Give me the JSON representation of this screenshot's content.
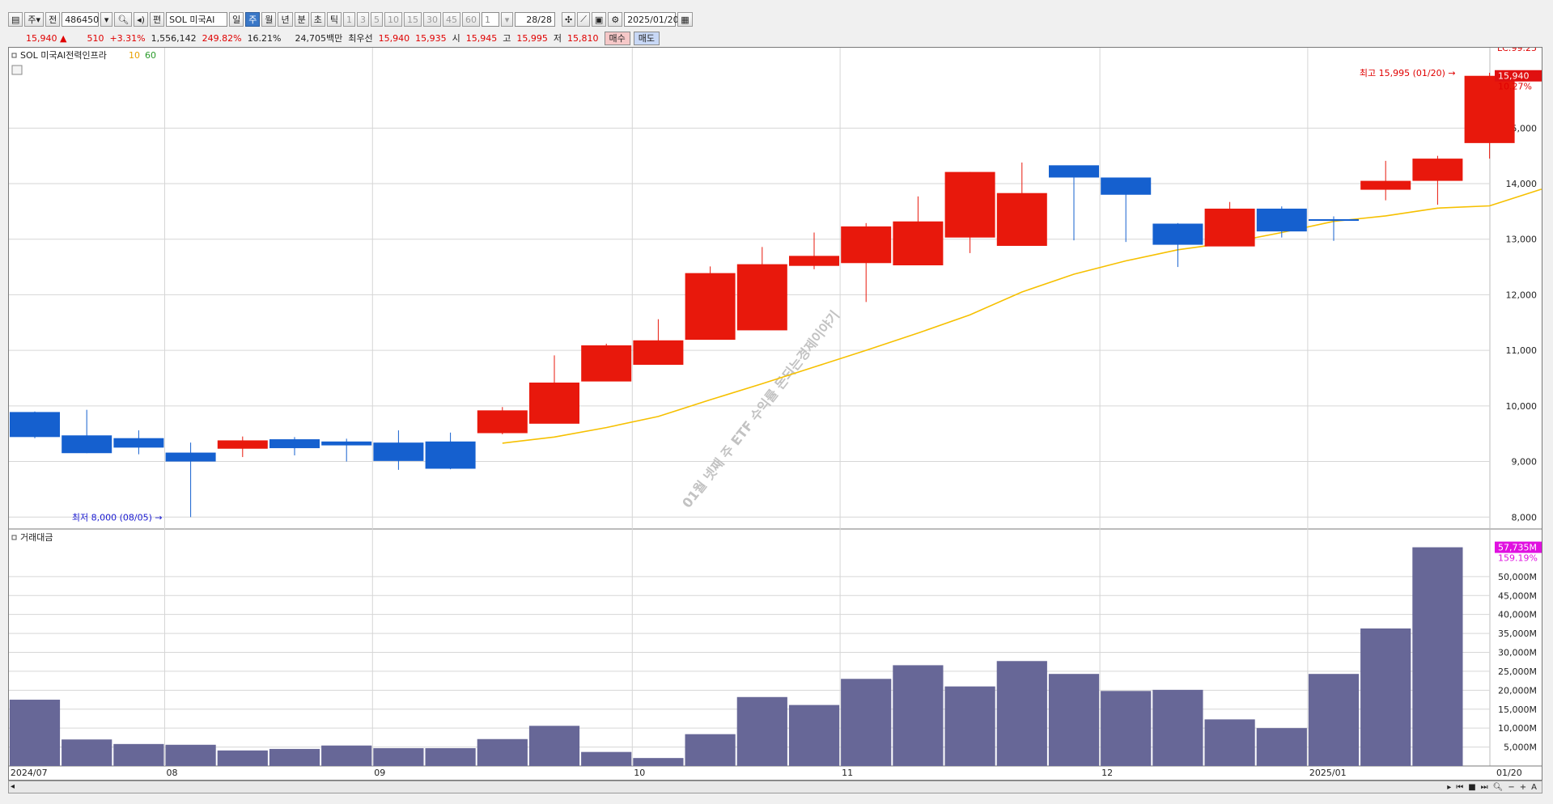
{
  "toolbar": {
    "period_items": [
      "주"
    ],
    "all_label": "전",
    "code": "486450",
    "edit_label": "편",
    "stock_name": "SOL 미국AI",
    "intervals": [
      "일",
      "주",
      "월",
      "년",
      "분",
      "초",
      "틱"
    ],
    "active_interval": "주",
    "minute_options": [
      "1",
      "3",
      "5",
      "10",
      "15",
      "30",
      "45",
      "60"
    ],
    "custom_value": "1",
    "count_display": "28/28",
    "date": "2025/01/20"
  },
  "quote": {
    "price": "15,940 ▲",
    "change": "510",
    "change_pct": "+3.31%",
    "volume": "1,556,142",
    "vol_ratio": "249.82%",
    "turnover": "16.21%",
    "amount": "24,705백만",
    "best_label": "최우선",
    "ask": "15,940",
    "bid": "15,935",
    "open_label": "시",
    "open": "15,945",
    "high_label": "고",
    "high": "15,995",
    "low_label": "저",
    "low": "15,810",
    "buy_label": "매수",
    "sell_label": "매도"
  },
  "price_panel": {
    "name": "SOL 미국AI전력인프라",
    "ma_labels": [
      "10",
      "60"
    ],
    "lc_label": "LC:99.25",
    "current_price_tag": "15,940",
    "current_pct": "10.27%",
    "high_annotation": "최고 15,995 (01/20)",
    "low_annotation": "최저 8,000 (08/05)",
    "watermark": "01월 넷째 주 ETF 수익률 돈되는경제이야기"
  },
  "volume_panel": {
    "name": "거래대금",
    "value_tag": "57,735M",
    "pct": "159.19%"
  },
  "colors": {
    "up": "#e8180c",
    "down": "#1560cf",
    "ma": "#f6c000",
    "volume": "#676797"
  },
  "chart_data": [
    {
      "type": "candlestick",
      "title": "SOL 미국AI전력인프라",
      "x": [
        "2024/07/08",
        "2024/07/15",
        "2024/07/22",
        "2024/07/29",
        "2024/08/05",
        "2024/08/12",
        "2024/08/19",
        "2024/08/26",
        "2024/09/02",
        "2024/09/09",
        "2024/09/16",
        "2024/09/23",
        "2024/09/30",
        "2024/10/07",
        "2024/10/14",
        "2024/10/21",
        "2024/10/28",
        "2024/11/04",
        "2024/11/11",
        "2024/11/18",
        "2024/11/25",
        "2024/12/02",
        "2024/12/09",
        "2024/12/16",
        "2024/12/23",
        "2024/12/30",
        "2025/01/06",
        "2025/01/13",
        "2025/01/20"
      ],
      "series": [
        {
          "open": [
            9890,
            9470,
            9420,
            9160,
            9230,
            9400,
            9360,
            9340,
            9360,
            9510,
            9680,
            10440,
            10740,
            11190,
            11360,
            12520,
            12570,
            12530,
            13030,
            12880,
            14330,
            14110,
            13280,
            12870,
            13550,
            13360,
            13890,
            14050,
            14730
          ],
          "high": [
            9900,
            9930,
            9560,
            9340,
            9450,
            9440,
            9410,
            9560,
            9520,
            9980,
            10910,
            11120,
            11560,
            12510,
            12860,
            13120,
            13290,
            13770,
            14210,
            14380,
            14180,
            14020,
            13290,
            13670,
            13590,
            13410,
            14410,
            14500,
            15995
          ],
          "low": [
            9420,
            9150,
            9130,
            8000,
            9080,
            9110,
            9000,
            8850,
            8860,
            9490,
            10390,
            10570,
            11100,
            11280,
            12320,
            12460,
            11870,
            13000,
            12750,
            13680,
            12980,
            12950,
            12500,
            13030,
            13030,
            12970,
            13700,
            13620,
            14450
          ],
          "close": [
            9440,
            9150,
            9250,
            9000,
            9380,
            9240,
            9290,
            9010,
            8870,
            9920,
            10420,
            11090,
            11180,
            12390,
            12550,
            12700,
            13230,
            13320,
            14210,
            13830,
            14110,
            13800,
            12900,
            13550,
            13140,
            13330,
            14050,
            14450,
            15940
          ]
        }
      ],
      "ma_values": [
        null,
        null,
        null,
        null,
        null,
        null,
        null,
        null,
        null,
        9330,
        9440,
        9610,
        9810,
        10110,
        10400,
        10700,
        11000,
        11310,
        11640,
        12050,
        12370,
        12610,
        12810,
        12940,
        13120,
        13320,
        13420,
        13560,
        13600,
        13900
      ],
      "x_ticks": [
        "2024/07",
        "08",
        "09",
        "10",
        "11",
        "12",
        "2025/01",
        "01/20"
      ],
      "y_ticks": [
        8000,
        9000,
        10000,
        11000,
        12000,
        13000,
        14000,
        15000
      ],
      "y_range": [
        7800,
        16300
      ],
      "grid": true
    },
    {
      "type": "bar",
      "title": "거래대금",
      "values": [
        17500,
        7000,
        5800,
        5600,
        4100,
        4500,
        5400,
        4700,
        4700,
        7100,
        10600,
        3700,
        2100,
        8400,
        18200,
        16100,
        23000,
        26600,
        21000,
        27700,
        24300,
        19800,
        20100,
        12300,
        10000,
        24300,
        36300,
        57735
      ],
      "y_ticks": [
        5000,
        10000,
        15000,
        20000,
        25000,
        30000,
        35000,
        40000,
        45000,
        50000
      ],
      "y_tick_labels": [
        "5,000M",
        "10,000M",
        "15,000M",
        "20,000M",
        "25,000M",
        "30,000M",
        "35,000M",
        "40,000M",
        "45,000M",
        "50,000M"
      ],
      "y_range": [
        0,
        60000
      ],
      "grid": true
    }
  ]
}
